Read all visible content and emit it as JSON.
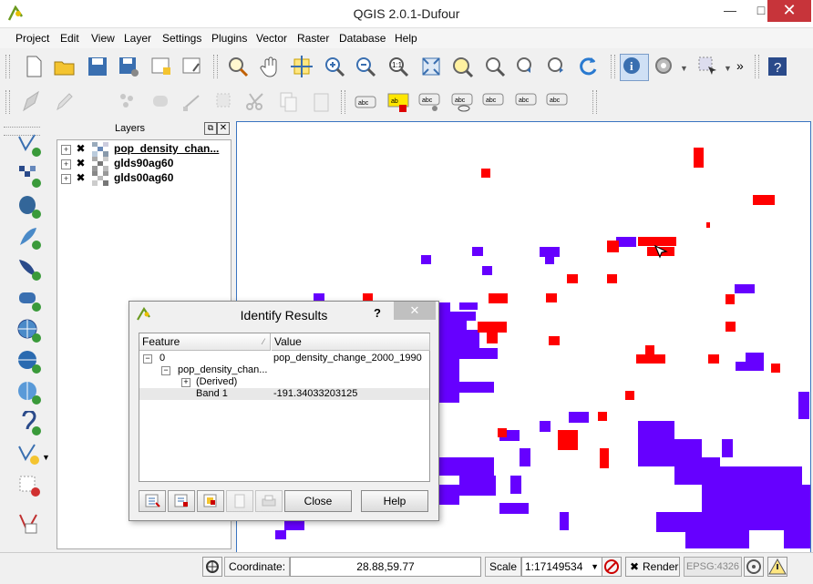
{
  "window": {
    "title": "QGIS 2.0.1-Dufour",
    "minimize": "—",
    "maximize": "□",
    "close": "✕"
  },
  "menu": [
    "Project",
    "Edit",
    "View",
    "Layer",
    "Settings",
    "Plugins",
    "Vector",
    "Raster",
    "Database",
    "Help"
  ],
  "toolbar_overflow": "»",
  "layers_panel": {
    "title": "Layers",
    "layers": [
      {
        "name": "pop_density_chan...",
        "checked": true
      },
      {
        "name": "glds90ag60",
        "checked": true
      },
      {
        "name": "glds00ag60",
        "checked": true
      }
    ]
  },
  "identify": {
    "title": "Identify Results",
    "help_glyph": "?",
    "close_glyph": "✕",
    "columns": [
      "Feature",
      "Value"
    ],
    "rows": [
      {
        "feature": "0",
        "value": "pop_density_change_2000_1990"
      },
      {
        "feature": "pop_density_chan...",
        "value": ""
      },
      {
        "feature": "(Derived)",
        "value": ""
      },
      {
        "feature": "Band 1",
        "value": "-191.34033203125"
      }
    ],
    "close_button": "Close",
    "help_button": "Help"
  },
  "statusbar": {
    "coordinate_label": "Coordinate:",
    "coordinate_value": "28.88,59.77",
    "scale_label": "Scale",
    "scale_value": "1:17149534",
    "render_label": "Render",
    "crs": "EPSG:4326"
  },
  "colors": {
    "increase": "#ff0000",
    "decrease": "#6600ff",
    "map_border": "#3a74c0"
  }
}
